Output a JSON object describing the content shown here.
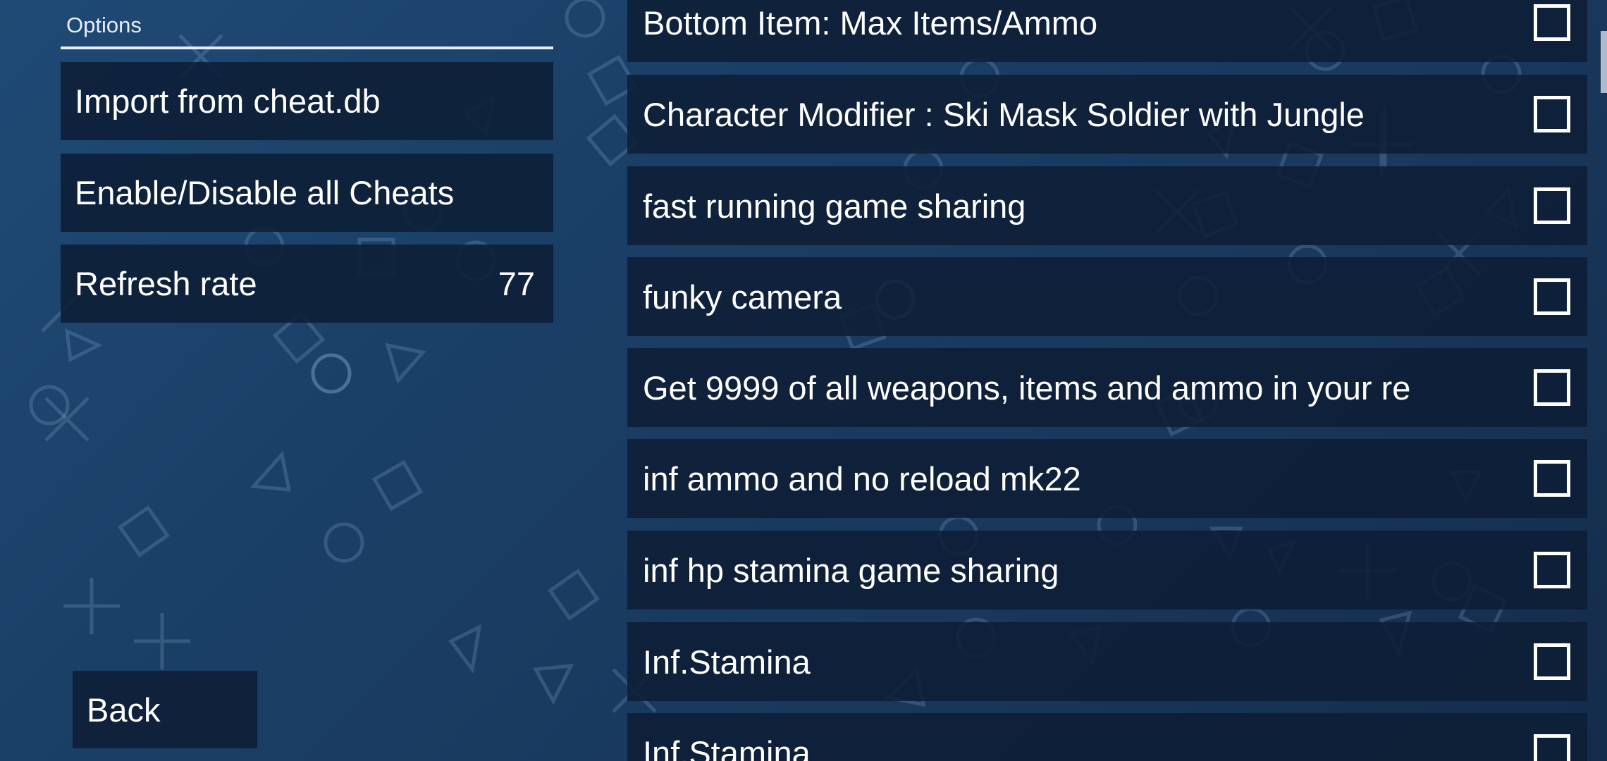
{
  "options": {
    "header": "Options",
    "items": [
      {
        "label": "Import from cheat.db",
        "value": ""
      },
      {
        "label": "Enable/Disable all Cheats",
        "value": ""
      },
      {
        "label": "Refresh rate",
        "value": "77"
      }
    ],
    "back_label": "Back"
  },
  "cheats": [
    {
      "label": "Bottom Item: Max Items/Ammo",
      "checked": false
    },
    {
      "label": "Character Modifier : Ski Mask Soldier with Jungle",
      "checked": false
    },
    {
      "label": "fast running game sharing",
      "checked": false
    },
    {
      "label": "funky camera",
      "checked": false
    },
    {
      "label": "Get 9999 of all weapons, items and ammo in your re",
      "checked": false
    },
    {
      "label": "inf ammo and no reload mk22",
      "checked": false
    },
    {
      "label": "inf hp stamina game sharing",
      "checked": false
    },
    {
      "label": "Inf.Stamina",
      "checked": false
    },
    {
      "label": "Inf.Stamina",
      "checked": false
    }
  ],
  "icons": {
    "checkbox": "checkbox-unchecked-icon",
    "background": "playstation-symbols"
  },
  "colors": {
    "background": "#1a3f66",
    "panel": "#0e1e36",
    "text": "#ffffff"
  }
}
